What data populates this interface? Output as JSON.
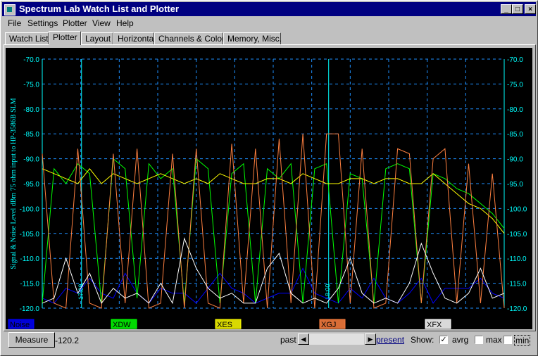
{
  "window": {
    "title": "Spectrum Lab  Watch List and Plotter"
  },
  "title_buttons": {
    "minimize": "_",
    "maximize": "□",
    "close": "×"
  },
  "menu": [
    "File",
    "Settings",
    "Plotter",
    "View",
    "Help"
  ],
  "tabs": [
    "Watch List",
    "Plotter",
    "Layout",
    "Horizontal",
    "Channels & Colors",
    "Memory, Misc."
  ],
  "active_tab": "Plotter",
  "chart_data": {
    "type": "line",
    "ylabel": "Signal & Noise Level  dBm 75 ohm input to HP-3586B SLM",
    "ylim": [
      -120,
      -70
    ],
    "yticks": [
      "-70.0",
      "-75.0",
      "-80.0",
      "-85.0",
      "-90.0",
      "-95.0",
      "-100.0",
      "-105.0",
      "-110.0",
      "-115.0",
      "-120.0"
    ],
    "grid": true,
    "time_markers": [
      "17:00",
      "18:00"
    ],
    "series": [
      {
        "name": "Noise",
        "color": "#0000ff",
        "values": [
          -118,
          -119,
          -116,
          -117,
          -114,
          -117,
          -118,
          -113,
          -117,
          -119,
          -116,
          -117,
          -117,
          -119,
          -116,
          -113,
          -116,
          -117,
          -119,
          -118,
          -117,
          -117,
          -112,
          -117,
          -118,
          -119,
          -116,
          -118,
          -114,
          -118,
          -119,
          -117,
          -114,
          -119,
          -116,
          -116,
          -116,
          -114,
          -117,
          -118
        ]
      },
      {
        "name": "XDW",
        "color": "#00ff00",
        "values": [
          -119,
          -92,
          -95,
          -91,
          -93,
          -119,
          -90,
          -92,
          -118,
          -91,
          -94,
          -92,
          -119,
          -90,
          -92,
          -119,
          -93,
          -91,
          -119,
          -92,
          -94,
          -91,
          -119,
          -92,
          -91,
          -119,
          -93,
          -94,
          -119,
          -92,
          -91,
          -92,
          -119,
          -93,
          -94,
          -96,
          -97,
          -99,
          -101,
          -104
        ]
      },
      {
        "name": "XES",
        "color": "#ffff00",
        "values": [
          -92,
          -93,
          -94,
          -95,
          -92,
          -95,
          -93,
          -94,
          -95,
          -94,
          -93,
          -94,
          -95,
          -94,
          -95,
          -93,
          -94,
          -95,
          -95,
          -94,
          -94,
          -95,
          -93,
          -94,
          -95,
          -95,
          -94,
          -94,
          -95,
          -94,
          -94,
          -95,
          -95,
          -93,
          -95,
          -97,
          -99,
          -100,
          -102,
          -105
        ]
      },
      {
        "name": "XGJ",
        "color": "#ff8040",
        "values": [
          -89,
          -119,
          -120,
          -88,
          -119,
          -120,
          -89,
          -119,
          -88,
          -120,
          -119,
          -89,
          -120,
          -88,
          -119,
          -120,
          -87,
          -119,
          -88,
          -120,
          -86,
          -119,
          -85,
          -120,
          -85,
          -85,
          -119,
          -88,
          -120,
          -119,
          -88,
          -89,
          -119,
          -90,
          -88,
          -119,
          -91,
          -119,
          -93,
          -120
        ]
      },
      {
        "name": "XFX",
        "color": "#ffffff",
        "values": [
          -119,
          -118,
          -110,
          -117,
          -113,
          -119,
          -116,
          -118,
          -117,
          -119,
          -115,
          -119,
          -106,
          -112,
          -116,
          -118,
          -117,
          -119,
          -119,
          -112,
          -109,
          -117,
          -119,
          -118,
          -119,
          -116,
          -110,
          -117,
          -119,
          -118,
          -119,
          -115,
          -107,
          -113,
          -118,
          -119,
          -117,
          -112,
          -118,
          -117
        ]
      }
    ]
  },
  "status": {
    "measure_label": "Measure",
    "measure_value": "-120.2",
    "past_label": "past",
    "present_label": "present",
    "show_label": "Show:",
    "avrg_label": "avrg",
    "max_label": "max",
    "min_label": "min",
    "avrg_checked": "✓",
    "scroll_left": "◀",
    "scroll_right": "▶"
  }
}
